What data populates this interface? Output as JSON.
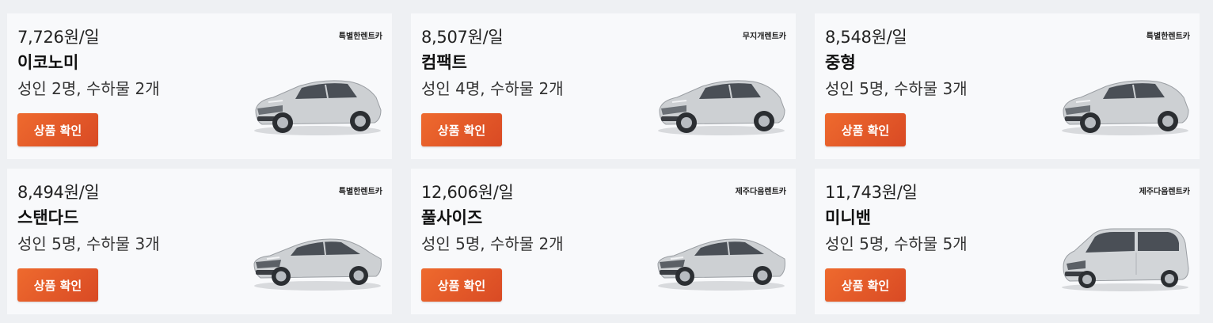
{
  "cards": [
    {
      "price": "7,726원/일",
      "name": "이코노미",
      "capacity": "성인 2명, 수하물 2개",
      "company": "특별한렌트카",
      "cta": "상품 확인",
      "car_icon": "hatchback-car-icon"
    },
    {
      "price": "8,507원/일",
      "name": "컴팩트",
      "capacity": "성인 4명, 수하물 2개",
      "company": "무지개렌트카",
      "cta": "상품 확인",
      "car_icon": "hatchback-car-icon"
    },
    {
      "price": "8,548원/일",
      "name": "중형",
      "capacity": "성인 5명, 수하물 3개",
      "company": "특별한렌트카",
      "cta": "상품 확인",
      "car_icon": "hatchback-car-icon"
    },
    {
      "price": "8,494원/일",
      "name": "스탠다드",
      "capacity": "성인 5명, 수하물 3개",
      "company": "특별한렌트카",
      "cta": "상품 확인",
      "car_icon": "sedan-car-icon"
    },
    {
      "price": "12,606원/일",
      "name": "풀사이즈",
      "capacity": "성인 5명, 수하물 2개",
      "company": "제주다음렌트카",
      "cta": "상품 확인",
      "car_icon": "sedan-car-icon"
    },
    {
      "price": "11,743원/일",
      "name": "미니밴",
      "capacity": "성인 5명, 수하물 5개",
      "company": "제주다음렌트카",
      "cta": "상품 확인",
      "car_icon": "minivan-car-icon"
    }
  ],
  "colors": {
    "accent": "#e8592a",
    "card_bg": "#f8f9fb",
    "page_bg": "#eef0f3",
    "car_body": "#c9cccf"
  }
}
